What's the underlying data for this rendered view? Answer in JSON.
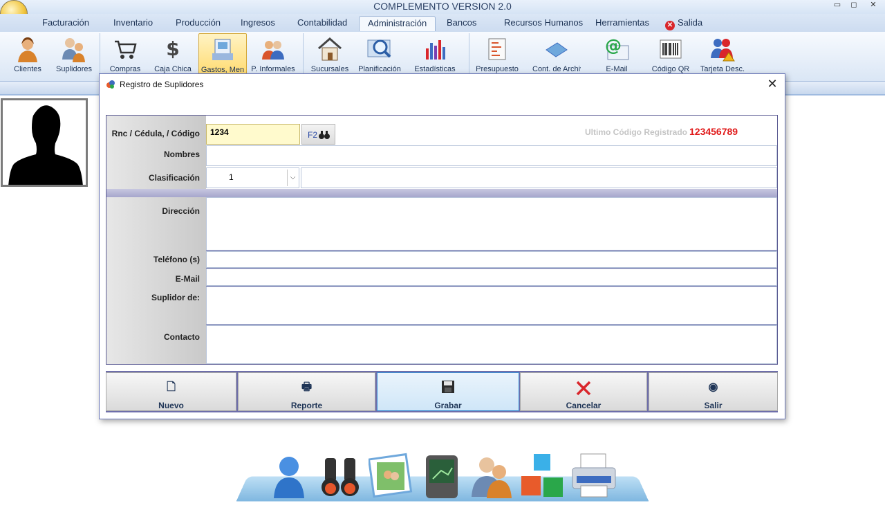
{
  "window": {
    "title": "COMPLEMENTO VERSION 2.0",
    "controls": [
      "▭",
      "◻",
      "✕"
    ]
  },
  "menu": [
    {
      "label": "Facturación"
    },
    {
      "label": "Inventario"
    },
    {
      "label": "Producción"
    },
    {
      "label": "Ingresos"
    },
    {
      "label": "Contabilidad"
    },
    {
      "label": "Administración",
      "active": true
    },
    {
      "label": "Bancos"
    },
    {
      "label": "Recursos Humanos"
    },
    {
      "label": "Herramientas"
    },
    {
      "label": "Salida",
      "icon": "exit-icon"
    }
  ],
  "ribbon": [
    {
      "label": "Clientes",
      "icon": "clients-icon"
    },
    {
      "label": "Suplidores",
      "icon": "suppliers-icon"
    },
    {
      "label": "Compras",
      "icon": "cart-icon"
    },
    {
      "label": "Caja Chica",
      "icon": "dollar-icon"
    },
    {
      "label": "Gastos, Men",
      "icon": "expenses-icon",
      "active": true
    },
    {
      "label": "P. Informales",
      "icon": "informal-people-icon"
    },
    {
      "label": "Sucursales",
      "icon": "house-icon"
    },
    {
      "label": "Planificación",
      "icon": "magnifier-icon"
    },
    {
      "label": "Estadísticas",
      "icon": "bar-chart-icon"
    },
    {
      "label": "Presupuesto",
      "icon": "budget-icon"
    },
    {
      "label": "Cont. de Archivo",
      "icon": "file-control-icon"
    },
    {
      "label": "E-Mail",
      "icon": "email-icon"
    },
    {
      "label": "Código QR",
      "icon": "barcode-icon"
    },
    {
      "label": "Tarjeta Desc.",
      "icon": "people-warning-icon"
    }
  ],
  "dialog": {
    "title": "Registro de Suplidores",
    "close": "✕",
    "fields": {
      "rnc_label": "Rnc / Cédula, / Código",
      "rnc_value": "1234",
      "f2_label": "F2",
      "ultimo_label": "Ultimo Código Registrado",
      "ultimo_value": "123456789",
      "nombres_label": "Nombres",
      "nombres_value": "",
      "clasificacion_label": "Clasificación",
      "clasificacion_value": "1",
      "clasificacion_desc": "",
      "direccion_label": "Dirección",
      "direccion_value": "",
      "telefono_label": "Teléfono (s)",
      "telefono_value": "",
      "email_label": "E-Mail",
      "email_value": "",
      "suplidor_label": "Suplidor de:",
      "suplidor_value": "",
      "contacto_label": "Contacto",
      "contacto_value": ""
    },
    "buttons": {
      "nuevo": "Nuevo",
      "reporte": "Reporte",
      "grabar": "Grabar",
      "cancelar": "Cancelar",
      "salir": "Salir"
    }
  },
  "dock": [
    "user-icon",
    "binoculars-icon",
    "photos-icon",
    "pda-icon",
    "contacts-icon",
    "cubes-icon",
    "printer-icon"
  ],
  "colors": {
    "accent": "#6e6eaa",
    "highlight_value": "#e01818",
    "rnc_field_bg": "#fffacd"
  }
}
